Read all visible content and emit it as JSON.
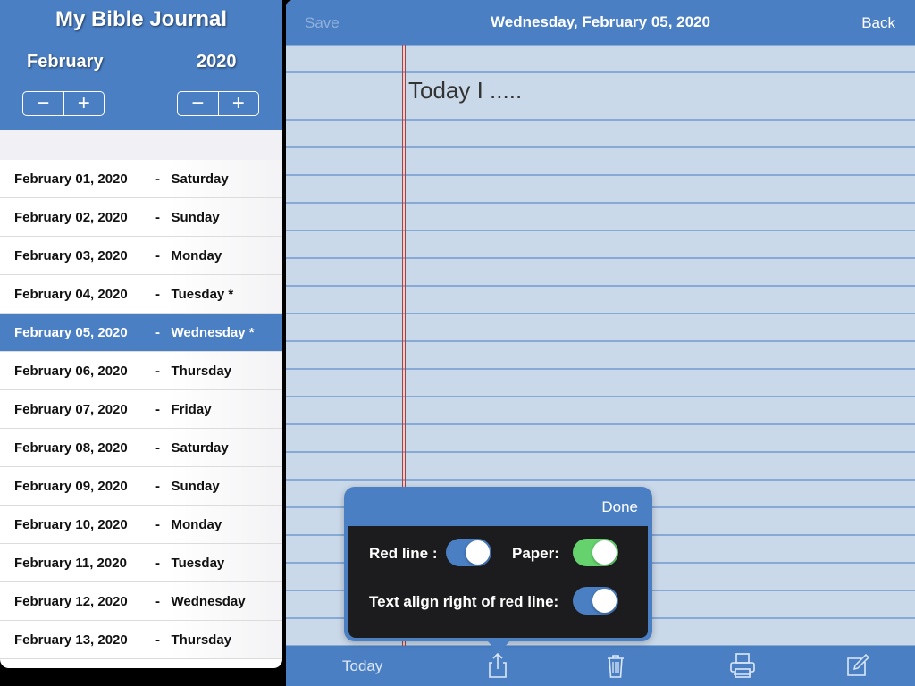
{
  "sidebar": {
    "app_title": "My Bible Journal",
    "month": "February",
    "year": "2020",
    "stepper_minus": "−",
    "stepper_plus": "+",
    "dates": [
      {
        "date": "February 01, 2020",
        "sep": "-",
        "day": "Saturday"
      },
      {
        "date": "February 02, 2020",
        "sep": "-",
        "day": "Sunday"
      },
      {
        "date": "February 03, 2020",
        "sep": "-",
        "day": "Monday"
      },
      {
        "date": "February 04, 2020",
        "sep": "-",
        "day": "Tuesday *"
      },
      {
        "date": "February 05, 2020",
        "sep": "-",
        "day": "Wednesday *"
      },
      {
        "date": "February 06, 2020",
        "sep": "-",
        "day": "Thursday"
      },
      {
        "date": "February 07, 2020",
        "sep": "-",
        "day": "Friday"
      },
      {
        "date": "February 08, 2020",
        "sep": "-",
        "day": "Saturday"
      },
      {
        "date": "February 09, 2020",
        "sep": "-",
        "day": "Sunday"
      },
      {
        "date": "February 10, 2020",
        "sep": "-",
        "day": "Monday"
      },
      {
        "date": "February 11, 2020",
        "sep": "-",
        "day": "Tuesday"
      },
      {
        "date": "February 12, 2020",
        "sep": "-",
        "day": "Wednesday"
      },
      {
        "date": "February 13, 2020",
        "sep": "-",
        "day": "Thursday"
      }
    ],
    "selected_index": 4
  },
  "topbar": {
    "save_label": "Save",
    "title": "Wednesday, February 05, 2020",
    "back_label": "Back"
  },
  "note": {
    "text": "Today I ....."
  },
  "bottombar": {
    "today_label": "Today",
    "icons": [
      "share-icon",
      "trash-icon",
      "print-icon",
      "compose-icon"
    ]
  },
  "popover": {
    "done_label": "Done",
    "red_line_label": "Red line :",
    "red_line_on": true,
    "paper_label": "Paper:",
    "paper_on": true,
    "align_label": "Text align right of red line:",
    "align_on": true
  },
  "colors": {
    "accent": "#4a7fc4",
    "toggle_blue": "#4a7fc4",
    "toggle_green": "#65d26e",
    "red_line": "#c0392b"
  }
}
